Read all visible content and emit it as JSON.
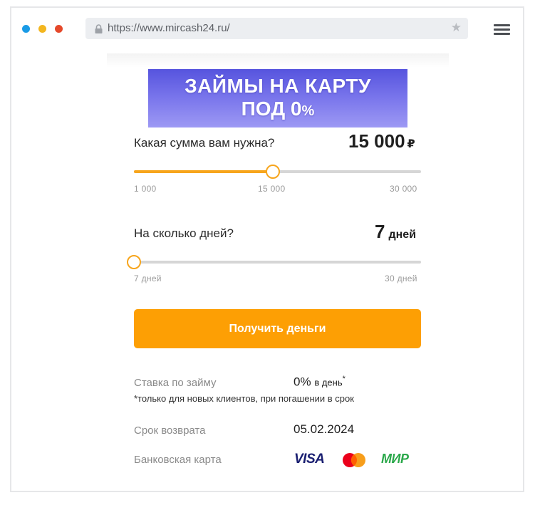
{
  "browser": {
    "url": "https://www.mircash24.ru/",
    "star_icon": "star-icon",
    "lock_icon": "lock-icon",
    "menu_icon": "hamburger-menu-icon",
    "dots_colors": [
      "#1a9be6",
      "#f3b61f",
      "#e5482a"
    ]
  },
  "banner": {
    "line1": "ЗАЙМЫ НА КАРТУ",
    "line2_main": "ПОД 0",
    "line2_suffix": "%"
  },
  "amount": {
    "question": "Какая сумма вам нужна?",
    "value": "15 000",
    "currency": "₽",
    "min_label": "1 000",
    "mid_label": "15 000",
    "max_label": "30 000",
    "min": 1000,
    "max": 30000,
    "current": 15000
  },
  "days": {
    "question": "На сколько дней?",
    "value": "7",
    "unit": "дней",
    "min_label": "7 дней",
    "max_label": "30 дней",
    "min": 7,
    "max": 30,
    "current": 7
  },
  "submit_label": "Получить деньги",
  "accent_color": "#fd9f04",
  "details": {
    "rate_label": "Ставка по займу",
    "rate_value": "0%",
    "rate_unit": "в день",
    "rate_mark": "*",
    "rate_note": "*только для новых клиентов, при погашении в срок",
    "return_label": "Срок возврата",
    "return_value": "05.02.2024",
    "card_label": "Банковская карта",
    "card_visa": "VISA",
    "card_mir": "МИР"
  }
}
